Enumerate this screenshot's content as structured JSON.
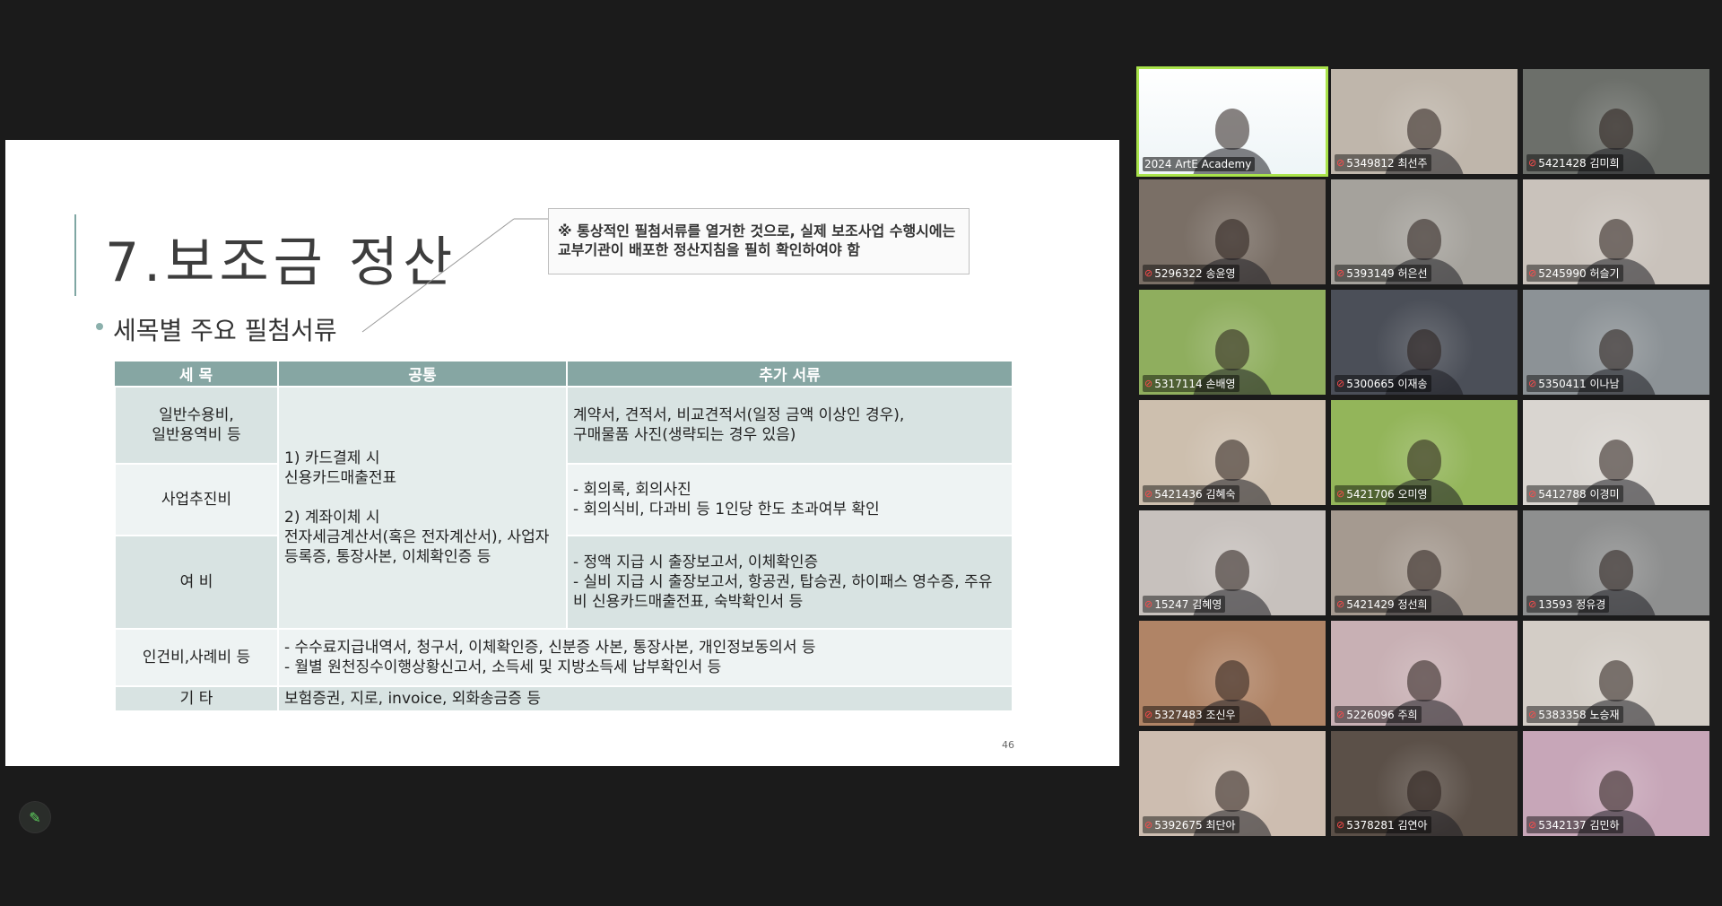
{
  "slide": {
    "title": "7.보조금 정산",
    "bullet": "세목별 주요 필첨서류",
    "note": "※ 통상적인 필첨서류를 열거한 것으로, 실제 보조사업 수행시에는 교부기관이 배포한 정산지침을 필히 확인하여야 함",
    "page_number": "46",
    "table": {
      "headers": [
        "세 목",
        "공통",
        "추가 서류"
      ],
      "rows": [
        {
          "category": "일반수용비,\n일반용역비 등",
          "extra": "계약서, 견적서, 비교견적서(일정 금액 이상인 경우),\n구매물품 사진(생략되는 경우 있음)"
        },
        {
          "category": "사업추진비",
          "extra": "- 회의록, 회의사진\n- 회의식비, 다과비 등 1인당 한도 초과여부 확인"
        },
        {
          "category": "여 비",
          "extra": "- 정액 지급 시 출장보고서, 이체확인증\n- 실비 지급 시 출장보고서, 항공권, 탑승권, 하이패스 영수증, 주유비 신용카드매출전표, 숙박확인서 등"
        },
        {
          "category": "인건비,사례비 등",
          "merged": "- 수수료지급내역서, 청구서, 이체확인증, 신분증 사본, 통장사본, 개인정보동의서 등\n- 월별 원천징수이행상황신고서, 소득세 및 지방소득세 납부확인서 등"
        },
        {
          "category": "기 타",
          "merged": "보험증권, 지로, invoice, 외화송금증 등"
        }
      ],
      "common": "1) 카드결제 시\n신용카드매출전표\n\n2) 계좌이체 시\n전자세금계산서(혹은 전자계산서), 사업자등록증, 통장사본, 이체확인증 등"
    }
  },
  "participants": [
    {
      "label": "2024 ArtE Academy",
      "host": true,
      "bg": "#f2f6f8"
    },
    {
      "label": "5349812 최선주",
      "bg": "#bfb6ab"
    },
    {
      "label": "5421428 김미희",
      "bg": "#6c6f6a"
    },
    {
      "label": "5296322 송윤영",
      "bg": "#7a6f66"
    },
    {
      "label": "5393149 허은선",
      "bg": "#a5a29c"
    },
    {
      "label": "5245990 허슬기",
      "bg": "#c9c2bb"
    },
    {
      "label": "5317114 손배영",
      "bg": "#8fae5e"
    },
    {
      "label": "5300665 이재송",
      "bg": "#4b4f58"
    },
    {
      "label": "5350411 이나남",
      "bg": "#8c9296"
    },
    {
      "label": "5421436 김혜숙",
      "bg": "#cdbfae"
    },
    {
      "label": "5421706 오미영",
      "bg": "#93b55a"
    },
    {
      "label": "5412788 이경미",
      "bg": "#d9d5d0"
    },
    {
      "label": "15247 김혜영",
      "bg": "#c7c1bd"
    },
    {
      "label": "5421429 정선희",
      "bg": "#a59a90"
    },
    {
      "label": "13593 정유경",
      "bg": "#8e8f8f"
    },
    {
      "label": "5327483 조신우",
      "bg": "#b08466"
    },
    {
      "label": "5226096 주희",
      "bg": "#c8b0b4"
    },
    {
      "label": "5383358 노승재",
      "bg": "#d3cdc6"
    },
    {
      "label": "5392675 최단아",
      "bg": "#cdbdb0"
    },
    {
      "label": "5378281 김연아",
      "bg": "#5b5048"
    },
    {
      "label": "5342137 김민하",
      "bg": "#c7a6b8"
    }
  ],
  "icons": {
    "mic_muted": "mic-muted-icon",
    "edit": "pencil-icon"
  }
}
